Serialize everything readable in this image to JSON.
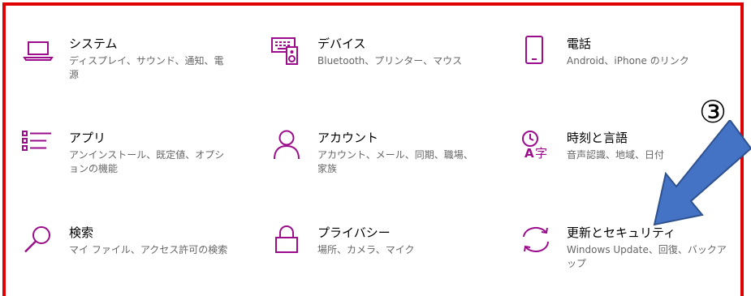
{
  "accent_color": "#9b0d8b",
  "frame_color": "#e00000",
  "arrow_color": "#4472c4",
  "annotation": {
    "marker": "③"
  },
  "settings": [
    {
      "title": "システム",
      "desc": "ディスプレイ、サウンド、通知、電源",
      "icon": "laptop-icon"
    },
    {
      "title": "デバイス",
      "desc": "Bluetooth、プリンター、マウス",
      "icon": "keyboard-speaker-icon"
    },
    {
      "title": "電話",
      "desc": "Android、iPhone のリンク",
      "icon": "phone-icon"
    },
    {
      "title": "アプリ",
      "desc": "アンインストール、既定値、オプションの機能",
      "icon": "apps-list-icon"
    },
    {
      "title": "アカウント",
      "desc": "アカウント、メール、同期、職場、家族",
      "icon": "person-icon"
    },
    {
      "title": "時刻と言語",
      "desc": "音声認識、地域、日付",
      "icon": "time-language-icon"
    },
    {
      "title": "検索",
      "desc": "マイ ファイル、アクセス許可の検索",
      "icon": "search-icon"
    },
    {
      "title": "プライバシー",
      "desc": "場所、カメラ、マイク",
      "icon": "lock-icon"
    },
    {
      "title": "更新とセキュリティ",
      "desc": "Windows Update、回復、バックアップ",
      "icon": "sync-icon"
    }
  ]
}
